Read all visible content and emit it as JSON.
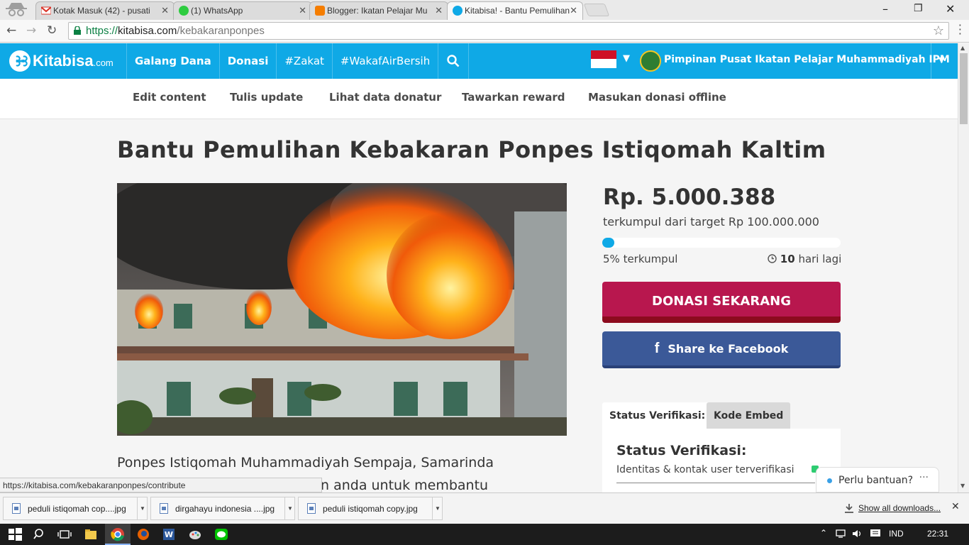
{
  "browser": {
    "tabs": [
      {
        "title": "Kotak Masuk (42) - pusati",
        "icon": "gmail-icon",
        "color": "#d93025"
      },
      {
        "title": "(1) WhatsApp",
        "icon": "whatsapp-icon",
        "color": "#2ecc40"
      },
      {
        "title": "Blogger: Ikatan Pelajar Mu",
        "icon": "blogger-icon",
        "color": "#f57d00"
      },
      {
        "title": "Kitabisa! - Bantu Pemulihan",
        "icon": "kitabisa-icon",
        "color": "#0fa9e6"
      }
    ],
    "url": {
      "scheme": "https://",
      "host": "kitabisa.com",
      "path": "/kebakaranponpes"
    },
    "status_url": "https://kitabisa.com/kebakaranponpes/contribute"
  },
  "header": {
    "logo_main": "Kitabisa",
    "logo_suffix": ".com",
    "nav": [
      "Galang Dana",
      "Donasi",
      "#Zakat",
      "#WakafAirBersih"
    ],
    "org_name": "Pimpinan Pusat Ikatan Pelajar Muhammadiyah IPM"
  },
  "submenu": [
    "Edit content",
    "Tulis update",
    "Lihat data donatur",
    "Tawarkan reward",
    "Masukan donasi offline"
  ],
  "campaign": {
    "title": "Bantu Pemulihan Kebakaran Ponpes Istiqomah Kaltim",
    "amount": "Rp. 5.000.388",
    "target": "terkumpul dari target Rp 100.000.000",
    "progress_fraction": 0.05,
    "progress_label": "5% terkumpul",
    "days_number": "10",
    "days_suffix": "hari lagi",
    "donate_button": "DONASI SEKARANG",
    "share_button": "Share ke Facebook",
    "description_line1": "Ponpes Istiqomah Muhammadiyah Sempaja, Samarinda",
    "description_line2": "n anda untuk membantu"
  },
  "verification": {
    "tab_status": "Status Verifikasi:",
    "tab_embed": "Kode Embed",
    "heading": "Status Verifikasi:",
    "row1": "Identitas & kontak user terverifikasi"
  },
  "help_widget": "Perlu bantuan?",
  "downloads": {
    "files": [
      "peduli istiqomah cop....jpg",
      "dirgahayu indonesia ....jpg",
      "peduli istiqomah copy.jpg"
    ],
    "show_all": "Show all downloads..."
  },
  "taskbar": {
    "language": "IND",
    "time": "22:31"
  },
  "colors": {
    "brand": "#0fa9e6",
    "donate": "#b8174e",
    "facebook": "#3b5998"
  }
}
